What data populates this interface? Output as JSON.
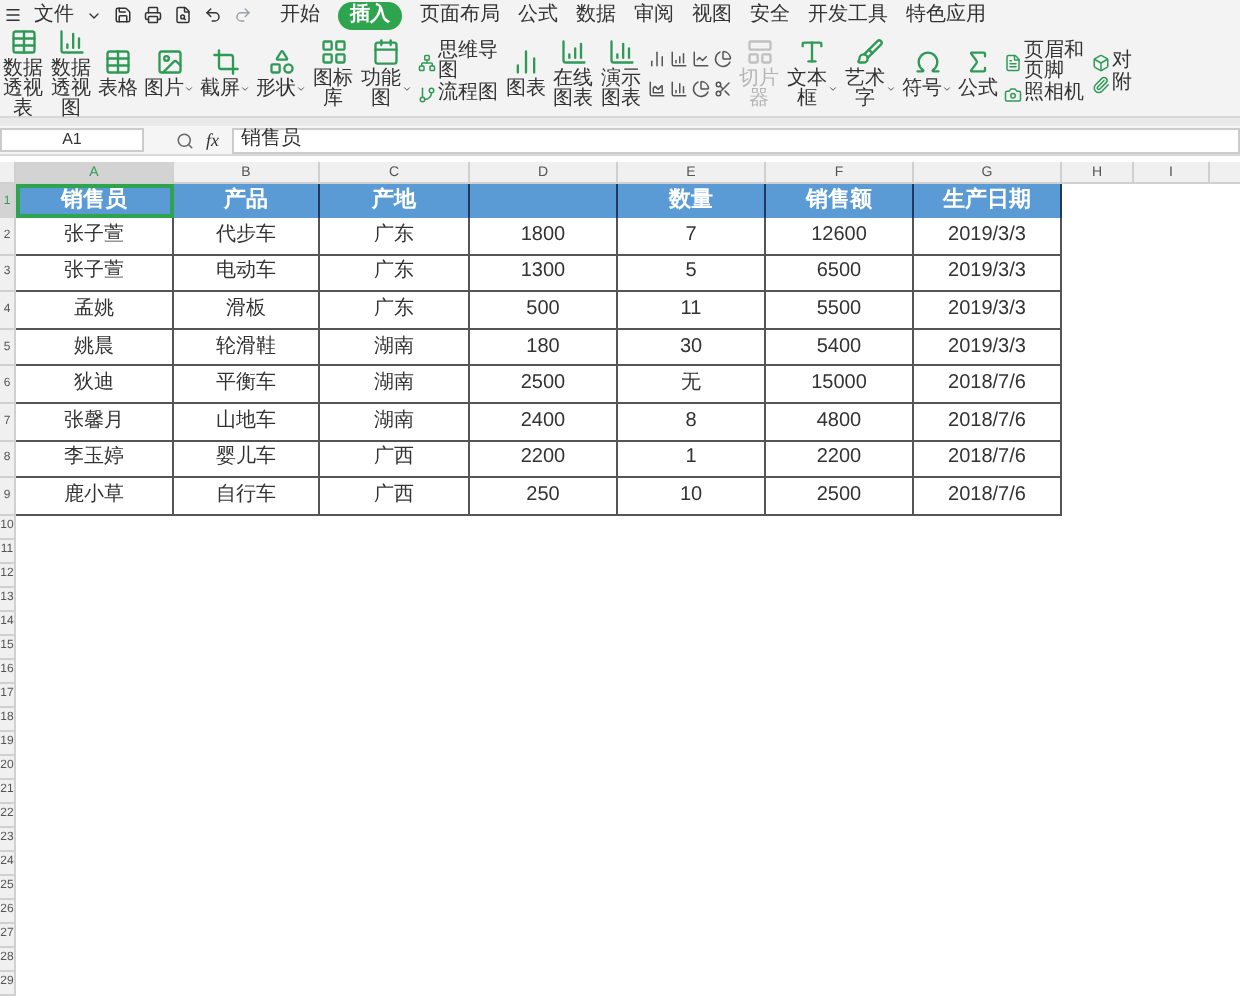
{
  "menu": {
    "file": "文件",
    "tabs": [
      {
        "label": "开始",
        "selected": false
      },
      {
        "label": "插入",
        "selected": true
      },
      {
        "label": "页面布局",
        "selected": false
      },
      {
        "label": "公式",
        "selected": false
      },
      {
        "label": "数据",
        "selected": false
      },
      {
        "label": "审阅",
        "selected": false
      },
      {
        "label": "视图",
        "selected": false
      },
      {
        "label": "安全",
        "selected": false
      },
      {
        "label": "开发工具",
        "selected": false
      },
      {
        "label": "特色应用",
        "selected": false
      }
    ]
  },
  "ribbon": [
    {
      "kind": "large",
      "label": "数据透视表",
      "dropdown": false,
      "disabled": false
    },
    {
      "kind": "large",
      "label": "数据透视图",
      "dropdown": false,
      "disabled": false
    },
    {
      "kind": "large",
      "label": "表格",
      "dropdown": false,
      "disabled": false
    },
    {
      "kind": "large",
      "label": "图片",
      "dropdown": true,
      "disabled": false
    },
    {
      "kind": "large",
      "label": "截屏",
      "dropdown": true,
      "disabled": false
    },
    {
      "kind": "large",
      "label": "形状",
      "dropdown": true,
      "disabled": false
    },
    {
      "kind": "large",
      "label": "图标库",
      "dropdown": false,
      "disabled": false
    },
    {
      "kind": "large",
      "label": "功能图",
      "dropdown": true,
      "disabled": false
    },
    {
      "kind": "stack",
      "items": [
        {
          "label": "思维导图"
        },
        {
          "label": "流程图"
        }
      ]
    },
    {
      "kind": "large",
      "label": "图表",
      "dropdown": false,
      "disabled": false
    },
    {
      "kind": "large",
      "label": "在线图表",
      "dropdown": false,
      "disabled": false
    },
    {
      "kind": "large",
      "label": "演示图表",
      "dropdown": false,
      "disabled": false
    },
    {
      "kind": "icons"
    },
    {
      "kind": "large",
      "label": "切片器",
      "dropdown": false,
      "disabled": true
    },
    {
      "kind": "large",
      "label": "文本框",
      "dropdown": true,
      "disabled": false
    },
    {
      "kind": "large",
      "label": "艺术字",
      "dropdown": true,
      "disabled": false
    },
    {
      "kind": "large",
      "label": "符号",
      "dropdown": true,
      "disabled": false
    },
    {
      "kind": "large",
      "label": "公式",
      "dropdown": false,
      "disabled": false
    },
    {
      "kind": "stack",
      "items": [
        {
          "label": "页眉和页脚"
        },
        {
          "label": "照相机"
        }
      ]
    },
    {
      "kind": "stack",
      "items": [
        {
          "label": "对"
        },
        {
          "label": "附"
        }
      ]
    }
  ],
  "formula_bar": {
    "cell_ref": "A1",
    "fx": "fx",
    "formula": "销售员"
  },
  "sheet": {
    "columns": [
      {
        "label": "A",
        "selected": true
      },
      {
        "label": "B",
        "selected": false
      },
      {
        "label": "C",
        "selected": false
      },
      {
        "label": "D",
        "selected": false
      },
      {
        "label": "E",
        "selected": false
      },
      {
        "label": "F",
        "selected": false
      },
      {
        "label": "G",
        "selected": false
      },
      {
        "label": "H",
        "selected": false
      },
      {
        "label": "I",
        "selected": false
      }
    ],
    "header_row": {
      "number": "1",
      "cells": [
        {
          "text": "销售员",
          "selected": true
        },
        {
          "text": "产品",
          "selected": false
        },
        {
          "text": "产地",
          "selected": false
        },
        {
          "selected": false
        },
        {
          "text": "数量",
          "selected": false
        },
        {
          "text": "销售额",
          "selected": false
        },
        {
          "text": "生产日期",
          "selected": false
        }
      ]
    },
    "rows": [
      {
        "number": "2",
        "cells": [
          "张子萱",
          "代步车",
          "广东",
          "1800",
          "7",
          "12600",
          "2019/3/3"
        ]
      },
      {
        "number": "3",
        "cells": [
          "张子萱",
          "电动车",
          "广东",
          "1300",
          "5",
          "6500",
          "2019/3/3"
        ]
      },
      {
        "number": "4",
        "cells": [
          "孟姚",
          "滑板",
          "广东",
          "500",
          "11",
          "5500",
          "2019/3/3"
        ]
      },
      {
        "number": "5",
        "cells": [
          "姚晨",
          "轮滑鞋",
          "湖南",
          "180",
          "30",
          "5400",
          "2019/3/3"
        ]
      },
      {
        "number": "6",
        "cells": [
          "狄迪",
          "平衡车",
          "湖南",
          "2500",
          "无",
          "15000",
          "2018/7/6"
        ]
      },
      {
        "number": "7",
        "cells": [
          "张馨月",
          "山地车",
          "湖南",
          "2400",
          "8",
          "4800",
          "2018/7/6"
        ]
      },
      {
        "number": "8",
        "cells": [
          "李玉婷",
          "婴儿车",
          "广西",
          "2200",
          "1",
          "2200",
          "2018/7/6"
        ]
      },
      {
        "number": "9",
        "cells": [
          "鹿小草",
          "自行车",
          "广西",
          "250",
          "10",
          "2500",
          "2018/7/6"
        ]
      }
    ],
    "empty_rows": [
      "10",
      "11",
      "12",
      "13",
      "14",
      "15",
      "16",
      "17",
      "18",
      "19",
      "20",
      "21",
      "22",
      "23",
      "24",
      "25",
      "26",
      "27",
      "28",
      "29"
    ]
  }
}
